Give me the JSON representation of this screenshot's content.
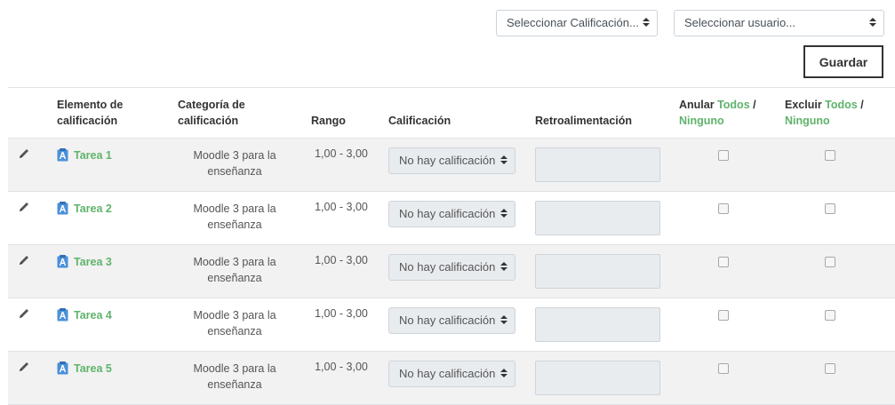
{
  "filters": {
    "grade_select": "Seleccionar Calificación...",
    "user_select": "Seleccionar usuario..."
  },
  "save_label": "Guardar",
  "headers": {
    "item": "Elemento de calificación",
    "category": "Categoría de calificación",
    "range": "Rango",
    "grade": "Calificación",
    "feedback": "Retroalimentación",
    "override": "Anular",
    "exclude": "Excluir",
    "all": "Todos",
    "slash": " /",
    "none": "Ninguno"
  },
  "rows": [
    {
      "name": "Tarea 1",
      "category": "Moodle 3 para la enseñanza",
      "range": "1,00 - 3,00",
      "grade": "No hay calificación"
    },
    {
      "name": "Tarea 2",
      "category": "Moodle 3 para la enseñanza",
      "range": "1,00 - 3,00",
      "grade": "No hay calificación"
    },
    {
      "name": "Tarea 3",
      "category": "Moodle 3 para la enseñanza",
      "range": "1,00 - 3,00",
      "grade": "No hay calificación"
    },
    {
      "name": "Tarea 4",
      "category": "Moodle 3 para la enseñanza",
      "range": "1,00 - 3,00",
      "grade": "No hay calificación"
    },
    {
      "name": "Tarea 5",
      "category": "Moodle 3 para la enseñanza",
      "range": "1,00 - 3,00",
      "grade": "No hay calificación"
    }
  ],
  "icons": {
    "edit": "pencil-icon",
    "assignment": "assignment-icon",
    "caret": "updown-caret-icon"
  },
  "colors": {
    "link": "#5fb36b",
    "row_alt": "#f2f2f2",
    "field_bg": "#e9ecef"
  }
}
